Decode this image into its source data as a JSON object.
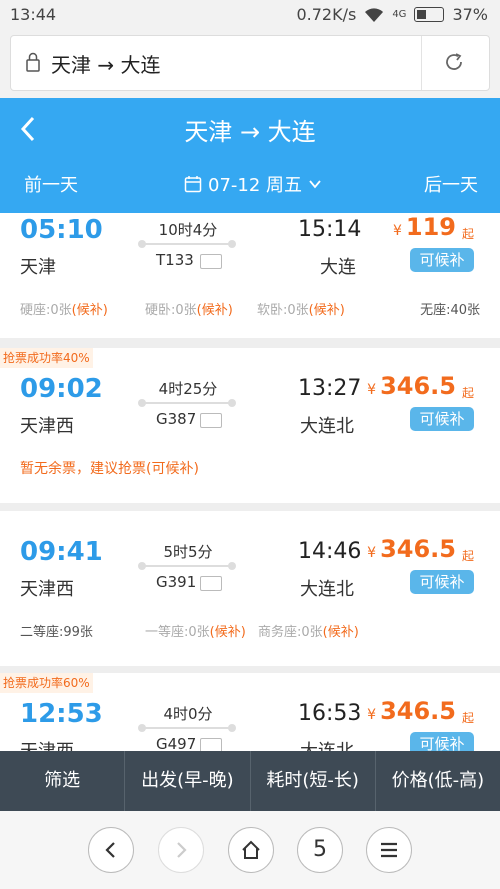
{
  "status_bar": {
    "time": "13:44",
    "speed": "0.72K/s",
    "network": "4G",
    "battery": "37%"
  },
  "url_bar": {
    "text": "天津 → 大连",
    "lock_icon": "lock-icon",
    "reload_icon": "reload-icon"
  },
  "header": {
    "title": "天津 → 大连",
    "prev_day": "前一天",
    "next_day": "后一天",
    "date": "07-12 周五",
    "back_icon": "chevron-left-icon",
    "calendar_icon": "calendar-icon"
  },
  "trains": [
    {
      "depart_time": "05:10",
      "depart_station": "天津",
      "duration": "10时4分",
      "train_no": "T133",
      "arrive_time": "15:14",
      "arrive_station": "大连",
      "price": "119",
      "price_suffix": "起",
      "button": "可候补",
      "seats": [
        {
          "name": "硬座:0张",
          "status": "(候补)"
        },
        {
          "name": "硬卧:0张",
          "status": "(候补)"
        },
        {
          "name": "软卧:0张",
          "status": "(候补)"
        },
        {
          "name": "无座:40张",
          "status": ""
        }
      ]
    },
    {
      "tag": "抢票成功率40%",
      "depart_time": "09:02",
      "depart_station": "天津西",
      "duration": "4时25分",
      "train_no": "G387",
      "arrive_time": "13:27",
      "arrive_station": "大连北",
      "price": "346.5",
      "price_suffix": "起",
      "button": "可候补",
      "note": "暂无余票，建议抢票(可候补)"
    },
    {
      "depart_time": "09:41",
      "depart_station": "天津西",
      "duration": "5时5分",
      "train_no": "G391",
      "arrive_time": "14:46",
      "arrive_station": "大连北",
      "price": "346.5",
      "price_suffix": "起",
      "button": "可候补",
      "seats": [
        {
          "name": "二等座:99张",
          "status": ""
        },
        {
          "name": "一等座:0张",
          "status": "(候补)"
        },
        {
          "name": "商务座:0张",
          "status": "(候补)"
        }
      ]
    },
    {
      "tag": "抢票成功率60%",
      "depart_time": "12:53",
      "depart_station": "天津西",
      "duration": "4时0分",
      "train_no": "G497",
      "arrive_time": "16:53",
      "arrive_station": "大连北",
      "price": "346.5",
      "price_suffix": "起",
      "button": "可候补"
    }
  ],
  "currency": "¥",
  "filter_bar": [
    "筛选",
    "出发(早-晚)",
    "耗时(短-长)",
    "价格(低-高)"
  ],
  "browser_nav": {
    "tab_count": "5"
  },
  "colors": {
    "accent": "#35a8f2",
    "price": "#f26b1d",
    "filter_bg": "#3e4a55"
  }
}
